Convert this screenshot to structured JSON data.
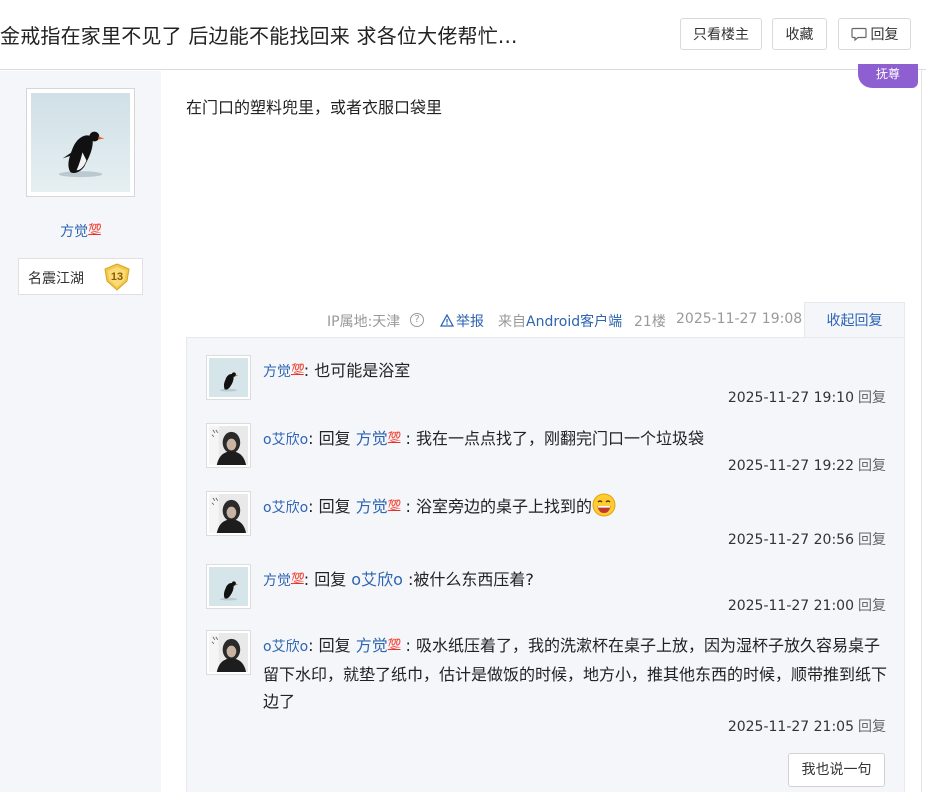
{
  "header": {
    "title": "金戒指在家里不见了 后边能不能找回来 求各位大佬帮忙...",
    "only_op_label": "只看楼主",
    "favorite_label": "收藏",
    "reply_label": "回复"
  },
  "author": {
    "name": "方觉",
    "level_name": "名震江湖",
    "level_number": "13"
  },
  "post": {
    "content": "在门口的塑料兜里，或者衣服口袋里",
    "badge": "抚尊"
  },
  "meta": {
    "ip": "IP属地:天津",
    "report": "举报",
    "from_prefix": "来自",
    "client": "Android客户端",
    "floor": "21楼",
    "time": "2025-11-27 19:08",
    "collapse": "收起回复"
  },
  "sub_replies": [
    {
      "user": "方觉",
      "avatar": "penguin-avatar",
      "text": "也可能是浴室",
      "time": "2025-11-27 19:10",
      "reply": "回复"
    },
    {
      "user": "o艾欣o",
      "avatar": "person-avatar",
      "prefix": "回复",
      "target": "方觉",
      "text": "我在一点点找了，刚翻完门口一个垃圾袋",
      "time": "2025-11-27 19:22",
      "reply": "回复"
    },
    {
      "user": "o艾欣o",
      "avatar": "person-avatar",
      "prefix": "回复",
      "target": "方觉",
      "text": "浴室旁边的桌子上找到的",
      "time": "2025-11-27 20:56",
      "reply": "回复"
    },
    {
      "user": "方觉",
      "avatar": "penguin-avatar",
      "prefix": "回复",
      "target": "o艾欣o",
      "text": "被什么东西压着?",
      "time": "2025-11-27 21:00",
      "reply": "回复"
    },
    {
      "user": "o艾欣o",
      "avatar": "person-avatar",
      "prefix": "回复",
      "target": "方觉",
      "text": "吸水纸压着了，我的洗漱杯在桌子上放，因为湿杯子放久容易桌子留下水印，就垫了纸巾，估计是做饭的时候，地方小，推其他东西的时候，顺带推到纸下边了",
      "time": "2025-11-27 21:05",
      "reply": "回复"
    }
  ],
  "say_button": "我也说一句",
  "colors": {
    "link": "#2d64b3",
    "panel": "#f4f6f9",
    "badge": "#8d5fd0"
  }
}
